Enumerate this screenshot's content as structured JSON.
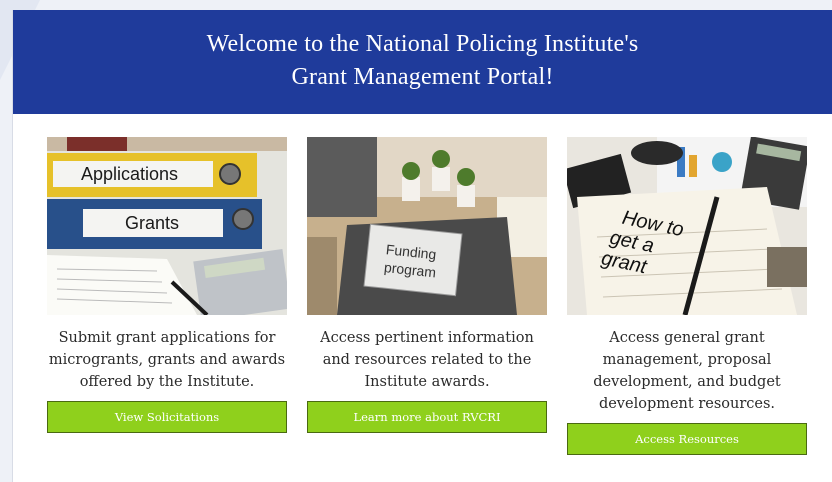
{
  "header": {
    "title_line1": "Welcome to the National Policing Institute's",
    "title_line2": "Grant Management Portal!"
  },
  "cards": [
    {
      "image_labels": {
        "top_binder": "Applications",
        "bottom_binder": "Grants"
      },
      "description": "Submit grant applications for microgrants, grants and awards offered by the Institute.",
      "button_label": "View Solicitations"
    },
    {
      "image_labels": {
        "line1": "Funding",
        "line2": "program"
      },
      "description": "Access pertinent information and resources related to the Institute awards.",
      "button_label": "Learn more about RVCRI"
    },
    {
      "image_labels": {
        "line1": "How to",
        "line2": "get a",
        "line3": "grant"
      },
      "description": "Access general grant management, proposal development, and budget development resources.",
      "button_label": "Access Resources"
    }
  ],
  "colors": {
    "header_bg": "#1f3b9b",
    "button_bg": "#8fd01c",
    "page_bg": "#eef1f7"
  }
}
